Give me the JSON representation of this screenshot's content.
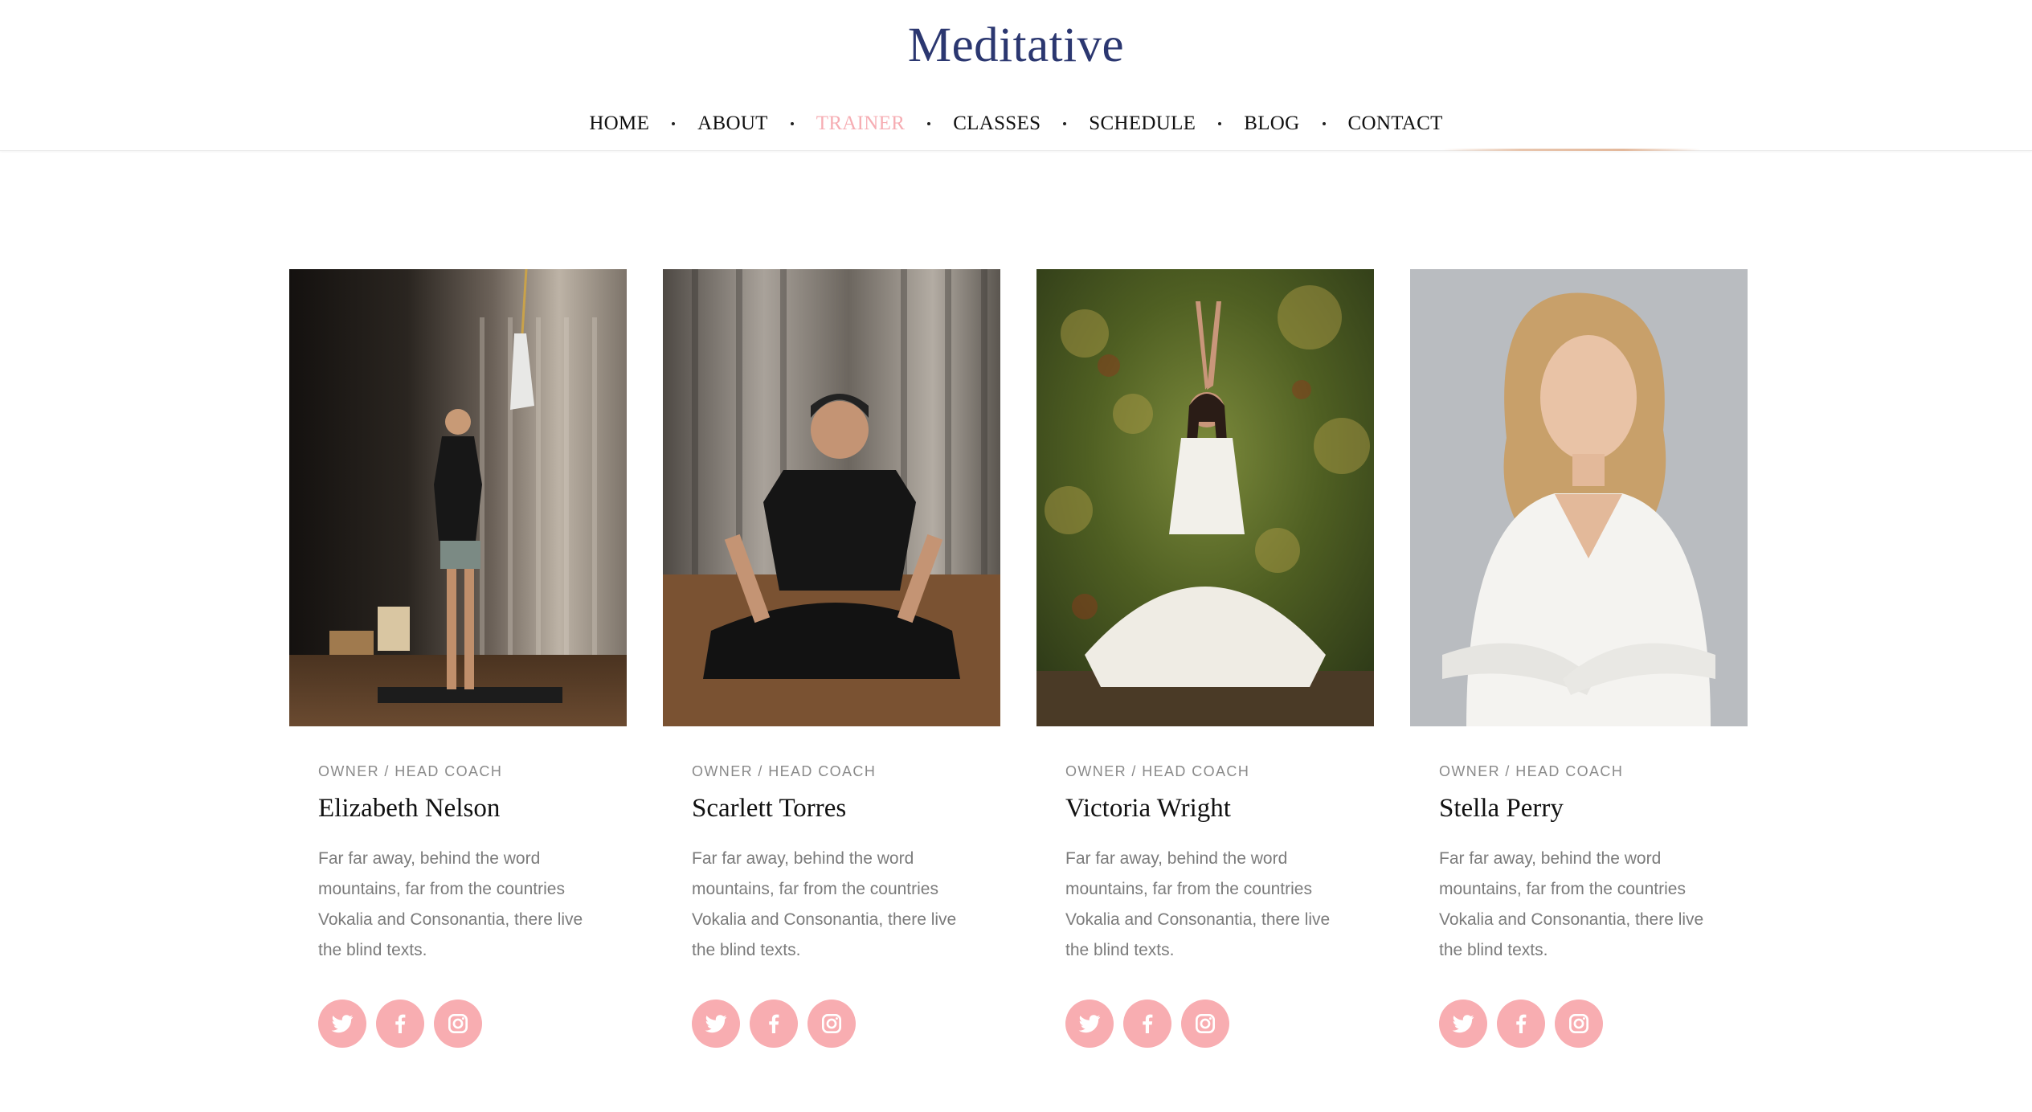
{
  "brand": "Meditative",
  "nav": [
    {
      "label": "HOME",
      "active": false
    },
    {
      "label": "ABOUT",
      "active": false
    },
    {
      "label": "TRAINER",
      "active": true
    },
    {
      "label": "CLASSES",
      "active": false
    },
    {
      "label": "SCHEDULE",
      "active": false
    },
    {
      "label": "BLOG",
      "active": false
    },
    {
      "label": "CONTACT",
      "active": false
    }
  ],
  "colors": {
    "accent": "#f8adb1",
    "brand": "#2b3770",
    "nav_active": "#f6adb3"
  },
  "trainers": [
    {
      "role": "OWNER / HEAD COACH",
      "name": "Elizabeth Nelson",
      "description": "Far far away, behind the word mountains, far from the countries Vokalia and Consonantia, there live the blind texts.",
      "photo_icon": "trainer-photo-standing-prayer",
      "socials": [
        "twitter-icon",
        "facebook-icon",
        "instagram-icon"
      ]
    },
    {
      "role": "OWNER / HEAD COACH",
      "name": "Scarlett Torres",
      "description": "Far far away, behind the word mountains, far from the countries Vokalia and Consonantia, there live the blind texts.",
      "photo_icon": "trainer-photo-seated-meditation",
      "socials": [
        "twitter-icon",
        "facebook-icon",
        "instagram-icon"
      ]
    },
    {
      "role": "OWNER / HEAD COACH",
      "name": "Victoria Wright",
      "description": "Far far away, behind the word mountains, far from the countries Vokalia and Consonantia, there live the blind texts.",
      "photo_icon": "trainer-photo-forest-pose",
      "socials": [
        "twitter-icon",
        "facebook-icon",
        "instagram-icon"
      ]
    },
    {
      "role": "OWNER / HEAD COACH",
      "name": "Stella Perry",
      "description": "Far far away, behind the word mountains, far from the countries Vokalia and Consonantia, there live the blind texts.",
      "photo_icon": "trainer-photo-portrait",
      "socials": [
        "twitter-icon",
        "facebook-icon",
        "instagram-icon"
      ]
    }
  ]
}
